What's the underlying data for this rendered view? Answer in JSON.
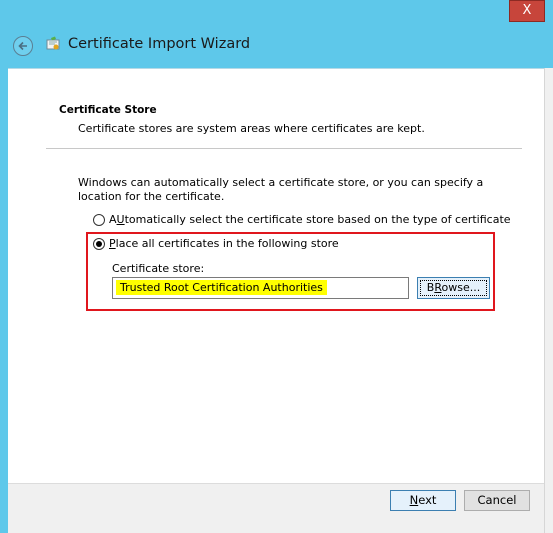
{
  "window": {
    "title": "Certificate Import Wizard",
    "close_symbol": "X"
  },
  "header": {
    "title": "Certificate Store",
    "subtitle": "Certificate stores are system areas where certificates are kept."
  },
  "description": "Windows can automatically select a certificate store, or you can specify a location for the certificate.",
  "options": [
    {
      "accel": "U",
      "rest": "tomatically select the certificate store based on the type of certificate",
      "prefix": "A",
      "checked": false
    },
    {
      "accel": "P",
      "rest": "lace all certificates in the following store",
      "prefix": "",
      "checked": true
    }
  ],
  "store": {
    "label": "Certificate store:",
    "value": "Trusted Root Certification Authorities",
    "browse_accel": "R",
    "browse_prefix": "B",
    "browse_rest": "owse..."
  },
  "footer": {
    "next_accel": "N",
    "next_rest": "ext",
    "cancel_label": "Cancel"
  },
  "icons": {
    "back": "back-arrow-icon",
    "wizard": "certificate-icon"
  }
}
